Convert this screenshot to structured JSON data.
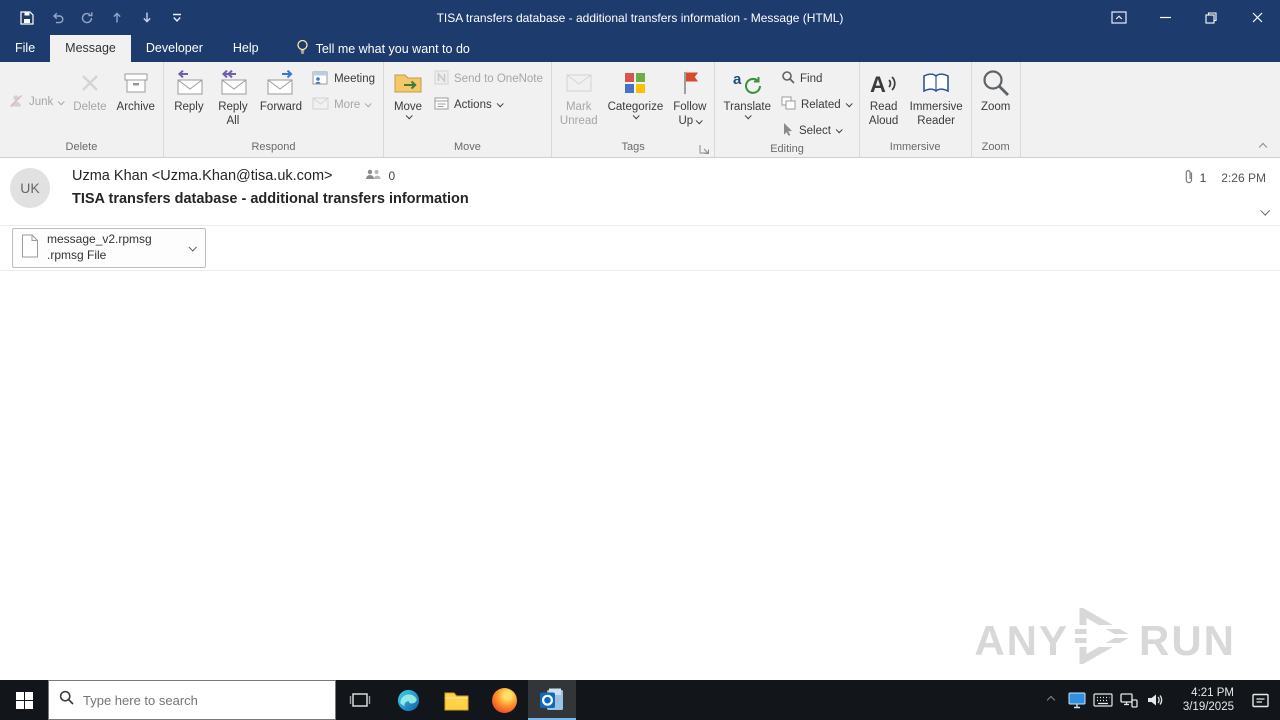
{
  "window": {
    "title": "TISA transfers database - additional transfers information  -  Message (HTML)"
  },
  "ribbon": {
    "tabs": [
      {
        "label": "File"
      },
      {
        "label": "Message"
      },
      {
        "label": "Developer"
      },
      {
        "label": "Help"
      }
    ],
    "tell_me": "Tell me what you want to do",
    "groups": [
      {
        "label": "Delete",
        "junk": "Junk",
        "delete": "Delete",
        "archive": "Archive"
      },
      {
        "label": "Respond",
        "reply": "Reply",
        "reply_all_1": "Reply",
        "reply_all_2": "All",
        "forward": "Forward",
        "meeting": "Meeting",
        "more": "More"
      },
      {
        "label": "Move",
        "move": "Move",
        "onenote": "Send to OneNote",
        "actions": "Actions"
      },
      {
        "label": "Tags",
        "unread_1": "Mark",
        "unread_2": "Unread",
        "categorize": "Categorize",
        "follow_1": "Follow",
        "follow_2": "Up"
      },
      {
        "label": "Editing",
        "translate": "Translate",
        "find": "Find",
        "related": "Related",
        "select": "Select"
      },
      {
        "label": "Immersive",
        "read_1": "Read",
        "read_2": "Aloud",
        "immersive_1": "Immersive",
        "immersive_2": "Reader"
      },
      {
        "label": "Zoom",
        "zoom": "Zoom"
      }
    ]
  },
  "message": {
    "avatar": "UK",
    "sender": "Uzma Khan <Uzma.Khan@tisa.uk.com>",
    "recipients_count": "0",
    "subject": "TISA transfers database - additional transfers information",
    "attachments_count": "1",
    "received_time": "2:26 PM",
    "attachment": {
      "filename": "message_v2.rpmsg",
      "filetype": ".rpmsg File"
    }
  },
  "watermark": {
    "left": "ANY",
    "right": "RUN"
  },
  "taskbar": {
    "search_placeholder": "Type here to search",
    "time": "4:21 PM",
    "date": "3/19/2025"
  }
}
